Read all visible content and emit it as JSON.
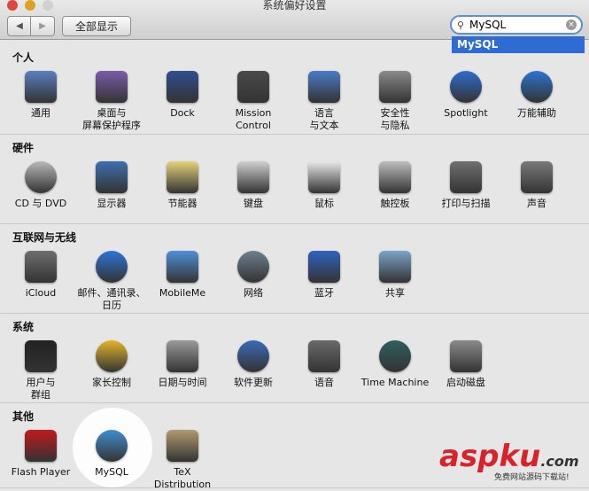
{
  "window": {
    "title": "系统偏好设置"
  },
  "toolbar": {
    "back": "◀",
    "forward": "▶",
    "show_all": "全部显示",
    "search_value": "MySQL",
    "suggestion": "MySQL"
  },
  "sections": [
    {
      "title": "个人",
      "items": [
        {
          "label": "通用",
          "icon": "general-icon",
          "color": "#5a7fbf"
        },
        {
          "label": "桌面与\n屏幕保护程序",
          "icon": "desktop-icon",
          "color": "#7b5ca8"
        },
        {
          "label": "Dock",
          "icon": "dock-icon",
          "color": "#2f4f8f"
        },
        {
          "label": "Mission\nControl",
          "icon": "mission-control-icon",
          "color": "#4a4a4a"
        },
        {
          "label": "语言\n与文本",
          "icon": "language-icon",
          "color": "#4a7bc8"
        },
        {
          "label": "安全性\n与隐私",
          "icon": "security-icon",
          "color": "#8a8a8a"
        },
        {
          "label": "Spotlight",
          "icon": "spotlight-icon",
          "color": "#2e6ccf"
        },
        {
          "label": "万能辅助",
          "icon": "accessibility-icon",
          "color": "#2b74d1"
        }
      ]
    },
    {
      "title": "硬件",
      "items": [
        {
          "label": "CD 与 DVD",
          "icon": "cd-dvd-icon",
          "color": "#b8b8b8"
        },
        {
          "label": "显示器",
          "icon": "display-icon",
          "color": "#3c6fb0"
        },
        {
          "label": "节能器",
          "icon": "energy-icon",
          "color": "#e6d27a"
        },
        {
          "label": "键盘",
          "icon": "keyboard-icon",
          "color": "#cfcfcf"
        },
        {
          "label": "鼠标",
          "icon": "mouse-icon",
          "color": "#e9e9e9"
        },
        {
          "label": "触控板",
          "icon": "trackpad-icon",
          "color": "#bdbdbd"
        },
        {
          "label": "打印与扫描",
          "icon": "printer-icon",
          "color": "#6f6f6f"
        },
        {
          "label": "声音",
          "icon": "sound-icon",
          "color": "#7a7a7a"
        }
      ]
    },
    {
      "title": "互联网与无线",
      "items": [
        {
          "label": "iCloud",
          "icon": "icloud-icon",
          "color": "#6e6e6e"
        },
        {
          "label": "邮件、通讯录、\n日历",
          "icon": "mail-icon",
          "color": "#2a74d6"
        },
        {
          "label": "MobileMe",
          "icon": "mobileme-icon",
          "color": "#4f8fd8"
        },
        {
          "label": "网络",
          "icon": "network-icon",
          "color": "#6e7e8e"
        },
        {
          "label": "蓝牙",
          "icon": "bluetooth-icon",
          "color": "#2f62c0"
        },
        {
          "label": "共享",
          "icon": "sharing-icon",
          "color": "#7aa3c8"
        }
      ]
    },
    {
      "title": "系统",
      "items": [
        {
          "label": "用户与\n群组",
          "icon": "users-icon",
          "color": "#222222"
        },
        {
          "label": "家长控制",
          "icon": "parental-icon",
          "color": "#e3b52a"
        },
        {
          "label": "日期与时间",
          "icon": "datetime-icon",
          "color": "#9a9a9a"
        },
        {
          "label": "软件更新",
          "icon": "software-update-icon",
          "color": "#3a6ab8"
        },
        {
          "label": "语音",
          "icon": "speech-icon",
          "color": "#6a6a6a"
        },
        {
          "label": "Time Machine",
          "icon": "time-machine-icon",
          "color": "#2f5f5f"
        },
        {
          "label": "启动磁盘",
          "icon": "startup-disk-icon",
          "color": "#8a8a8a"
        }
      ]
    },
    {
      "title": "其他",
      "items": [
        {
          "label": "Flash Player",
          "icon": "flash-icon",
          "color": "#c2191c"
        },
        {
          "label": "MySQL",
          "icon": "mysql-icon",
          "color": "#3f8ed0"
        },
        {
          "label": "TeX\nDistribution",
          "icon": "tex-icon",
          "color": "#b09a70"
        }
      ]
    }
  ],
  "watermark": {
    "brand": "aspku",
    "suffix": ".com",
    "tagline": "免费网站源码下载站!"
  }
}
